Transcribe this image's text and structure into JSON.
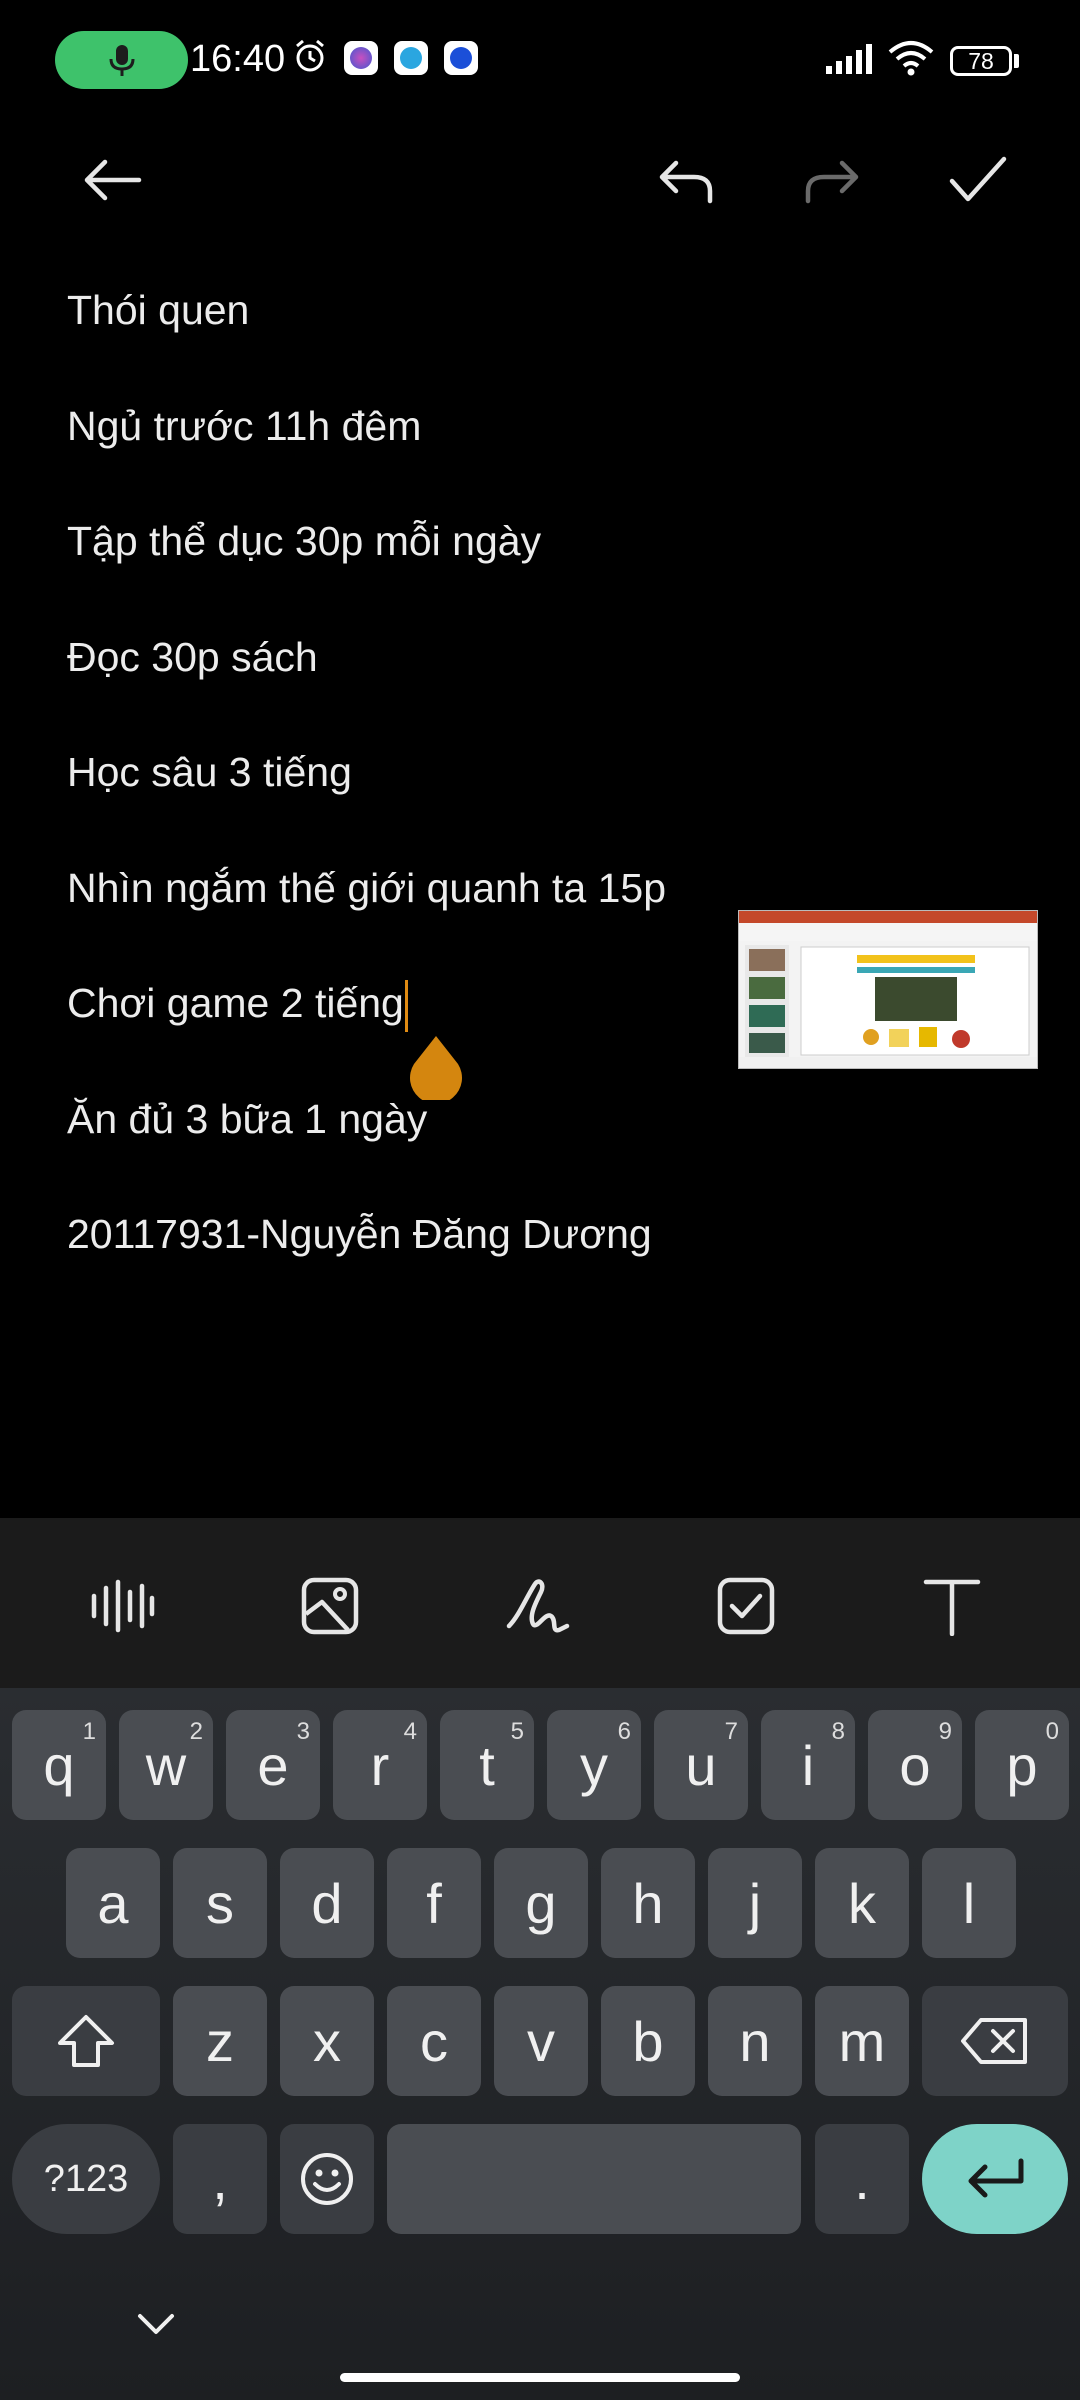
{
  "status": {
    "time": "16:40",
    "battery": "78",
    "app_badges": [
      "messenger",
      "upload",
      "other-app"
    ]
  },
  "toolbar": {
    "back": "back-arrow-icon",
    "undo": "undo-icon",
    "redo": "redo-icon",
    "done": "check-icon"
  },
  "note": {
    "lines": [
      "Thói quen",
      "Ngủ trước 11h đêm",
      "Tập thể dục 30p mỗi ngày",
      "Đọc 30p sách",
      "Học sâu 3 tiếng",
      "Nhìn ngắm thế giới quanh ta 15p",
      "Chơi game 2 tiếng",
      "Ăn đủ 3 bữa 1 ngày",
      "20117931-Nguyễn Đăng Dương"
    ]
  },
  "tools": [
    "audio-icon",
    "image-icon",
    "draw-icon",
    "checklist-icon",
    "text-format-icon"
  ],
  "keyboard": {
    "row1": [
      {
        "k": "q",
        "n": "1"
      },
      {
        "k": "w",
        "n": "2"
      },
      {
        "k": "e",
        "n": "3"
      },
      {
        "k": "r",
        "n": "4"
      },
      {
        "k": "t",
        "n": "5"
      },
      {
        "k": "y",
        "n": "6"
      },
      {
        "k": "u",
        "n": "7"
      },
      {
        "k": "i",
        "n": "8"
      },
      {
        "k": "o",
        "n": "9"
      },
      {
        "k": "p",
        "n": "0"
      }
    ],
    "row2": [
      "a",
      "s",
      "d",
      "f",
      "g",
      "h",
      "j",
      "k",
      "l"
    ],
    "row3": [
      "z",
      "x",
      "c",
      "v",
      "b",
      "n",
      "m"
    ],
    "symbols": "?123",
    "comma": ",",
    "period": "."
  },
  "colors": {
    "accent_cursor": "#e08b13",
    "mic_pill": "#3ec26b",
    "enter_key": "#7ed3c8"
  }
}
